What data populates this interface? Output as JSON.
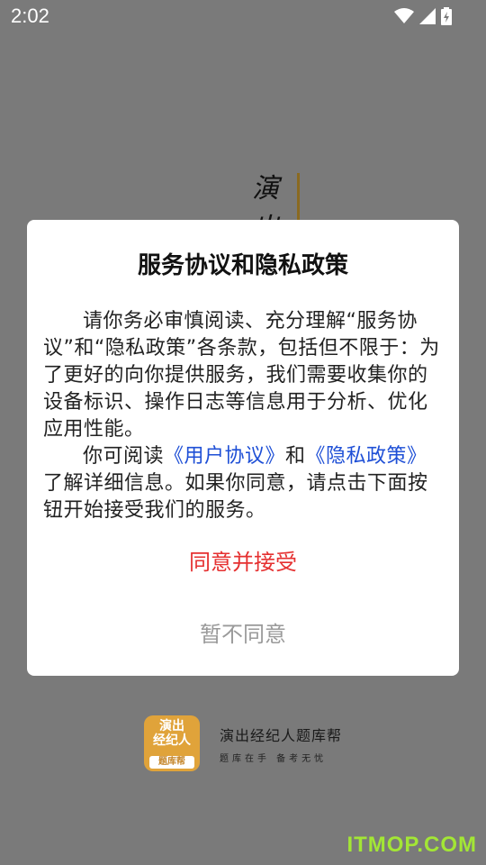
{
  "status_bar": {
    "time": "2:02"
  },
  "splash": {
    "title_chars": [
      "演",
      "出"
    ],
    "brand_name": "演出经纪人题库帮",
    "brand_tagline": "题库在手 备考无忧",
    "logo_line1": "演出",
    "logo_line2": "经纪人",
    "logo_line3": "题库帮"
  },
  "dialog": {
    "title": "服务协议和隐私政策",
    "para1": "请你务必审慎阅读、充分理解“服务协议”和“隐私政策”各条款，包括但不限于：为了更好的向你提供服务，我们需要收集你的设备标识、操作日志等信息用于分析、优化应用性能。",
    "para2_prefix": "你可阅读",
    "user_agreement_link": "《用户协议》",
    "para2_and": "和",
    "privacy_policy_link": "《隐私政策》",
    "para2_suffix": "了解详细信息。如果你同意，请点击下面按钮开始接受我们的服务。",
    "agree_label": "同意并接受",
    "decline_label": "暂不同意"
  },
  "watermark": "ITMOP.COM"
}
